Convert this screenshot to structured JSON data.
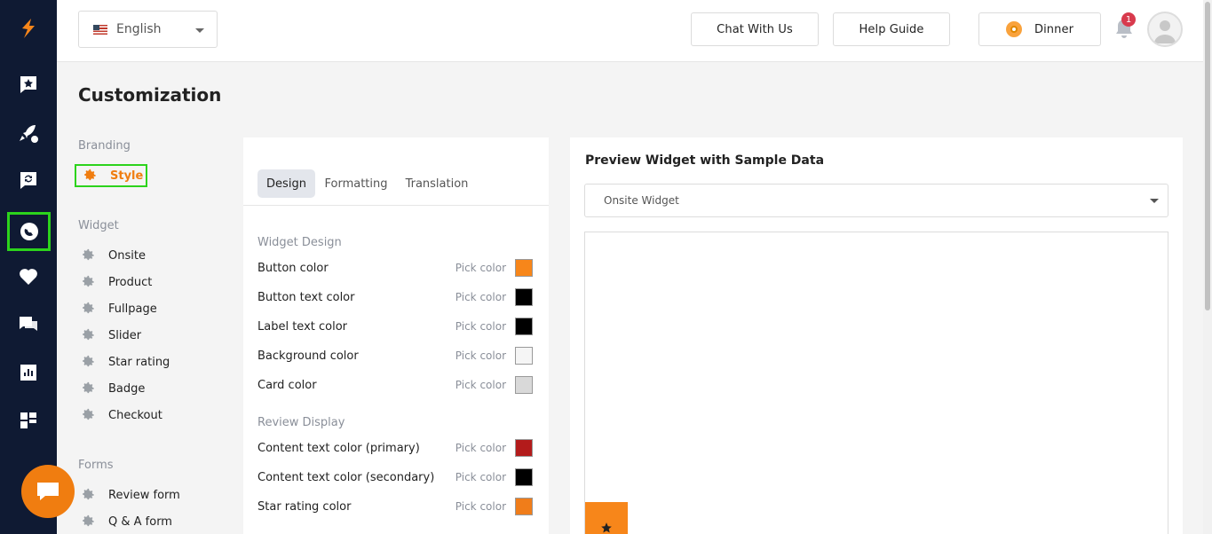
{
  "topbar": {
    "language": "English",
    "chat_button": "Chat With Us",
    "help_button": "Help Guide",
    "store_name": "Dinner",
    "notification_count": "1"
  },
  "page": {
    "title": "Customization"
  },
  "subnav": {
    "branding_head": "Branding",
    "style": "Style",
    "widget_head": "Widget",
    "widget_items": [
      "Onsite",
      "Product",
      "Fullpage",
      "Slider",
      "Star rating",
      "Badge",
      "Checkout"
    ],
    "forms_head": "Forms",
    "form_items": [
      "Review form",
      "Q & A form"
    ]
  },
  "design": {
    "tabs": [
      "Design",
      "Formatting",
      "Translation"
    ],
    "widget_design_label": "Widget Design",
    "pick_label": "Pick color",
    "widget_design": [
      {
        "label": "Button color",
        "color": "#f7861a"
      },
      {
        "label": "Button text color",
        "color": "#000000"
      },
      {
        "label": "Label text color",
        "color": "#000000"
      },
      {
        "label": "Background color",
        "color": "#f5f5f5"
      },
      {
        "label": "Card color",
        "color": "#d9d9d9"
      }
    ],
    "review_display_label": "Review Display",
    "review_display": [
      {
        "label": "Content text color (primary)",
        "color": "#b31b1b"
      },
      {
        "label": "Content text color (secondary)",
        "color": "#000000"
      },
      {
        "label": "Star rating color",
        "color": "#f07d1a"
      }
    ]
  },
  "preview": {
    "title": "Preview Widget with Sample Data",
    "selected": "Onsite Widget"
  },
  "colors": {
    "accent": "#f07d10",
    "rail": "#0f1a33",
    "highlight": "#2cd31c"
  }
}
